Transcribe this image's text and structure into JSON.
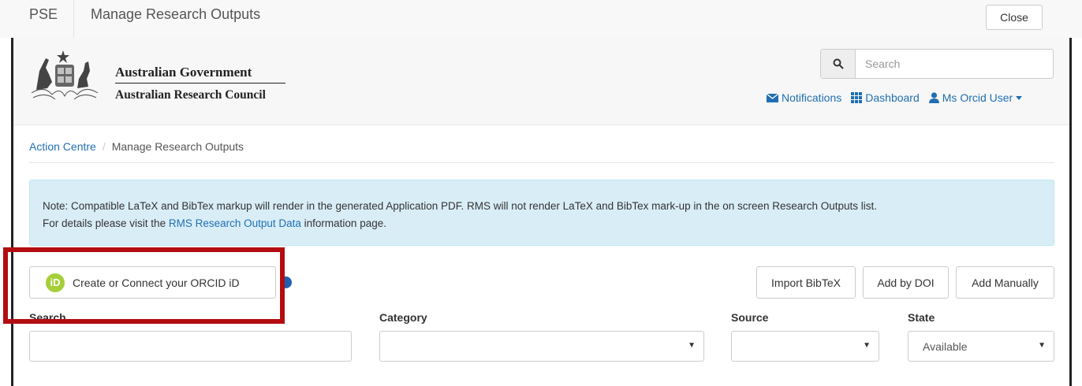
{
  "topbar": {
    "brand": "PSE",
    "title": "Manage Research Outputs",
    "close_label": "Close"
  },
  "header": {
    "gov_name": "Australian Government",
    "council_name": "Australian Research Council",
    "search": {
      "placeholder": "Search",
      "icon": "search-icon"
    },
    "nav": {
      "notifications": "Notifications",
      "dashboard": "Dashboard",
      "user": "Ms Orcid User"
    }
  },
  "breadcrumb": {
    "root": "Action Centre",
    "separator": "/",
    "current": "Manage Research Outputs"
  },
  "alert": {
    "line1": "Note: Compatible LaTeX and BibTex markup will render in the generated Application PDF. RMS will not render LaTeX and BibTex mark-up in the on screen Research Outputs list.",
    "line2_prefix": "For details please visit the ",
    "line2_link": "RMS Research Output Data",
    "line2_suffix": " information page."
  },
  "actions": {
    "orcid_label": "Create or Connect your ORCID iD",
    "orcid_logo_text": "iD",
    "import_bibtex": "Import BibTeX",
    "add_by_doi": "Add by DOI",
    "add_manually": "Add Manually"
  },
  "filters": {
    "search_label": "Search",
    "category_label": "Category",
    "source_label": "Source",
    "state_label": "State",
    "state_value": "Available",
    "caret": "▼"
  },
  "colors": {
    "link": "#1f6fb2",
    "alert_bg": "#d9edf7",
    "highlight": "#b30d12",
    "orcid_green": "#a6ce39"
  }
}
